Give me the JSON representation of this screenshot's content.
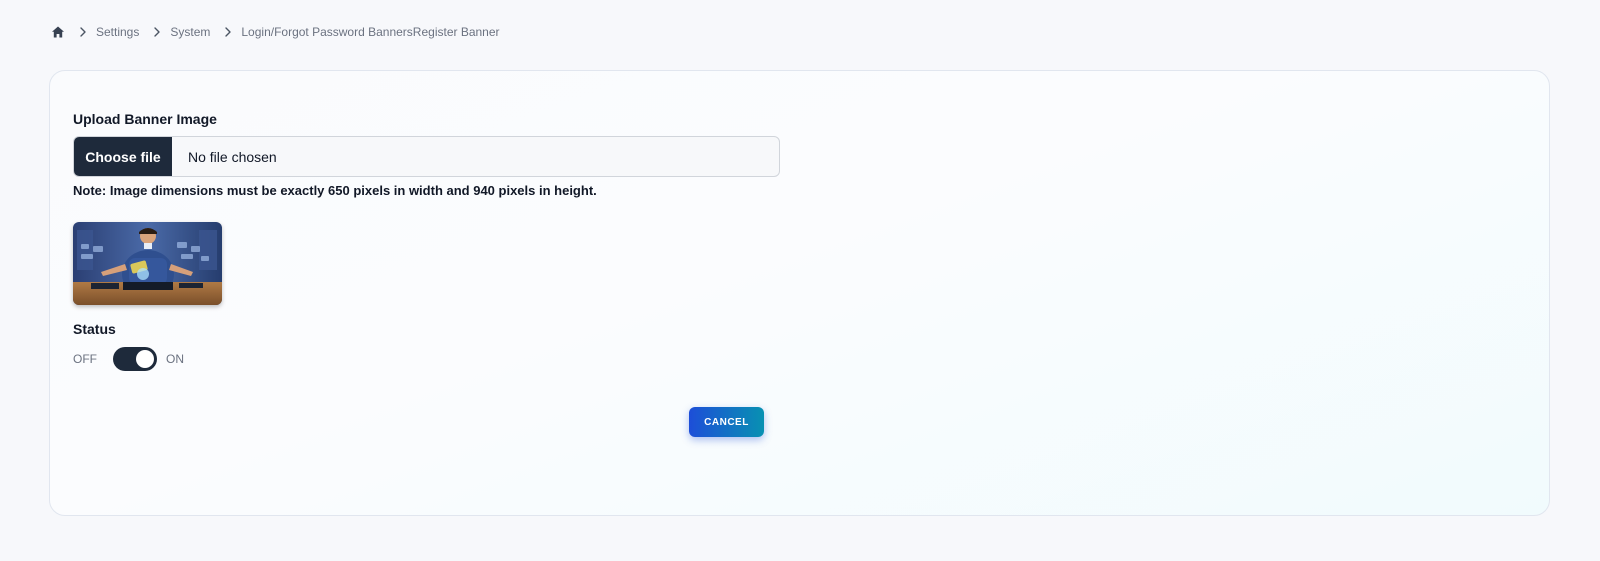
{
  "breadcrumb": {
    "home_icon": "home-icon",
    "items": [
      "Settings",
      "System",
      "Login/Forgot Password BannersRegister Banner"
    ]
  },
  "form": {
    "upload_label": "Upload Banner Image",
    "file_button": "Choose file",
    "file_status": "No file chosen",
    "note": "Note: Image dimensions must be exactly 650 pixels in width and 940 pixels in height.",
    "status_label": "Status",
    "toggle_off": "OFF",
    "toggle_on": "ON",
    "status_on": true,
    "cancel_label": "CANCEL"
  },
  "colors": {
    "primary_dark": "#1e2a3b",
    "accent_start": "#1d4ed8",
    "accent_end": "#0891b2"
  }
}
